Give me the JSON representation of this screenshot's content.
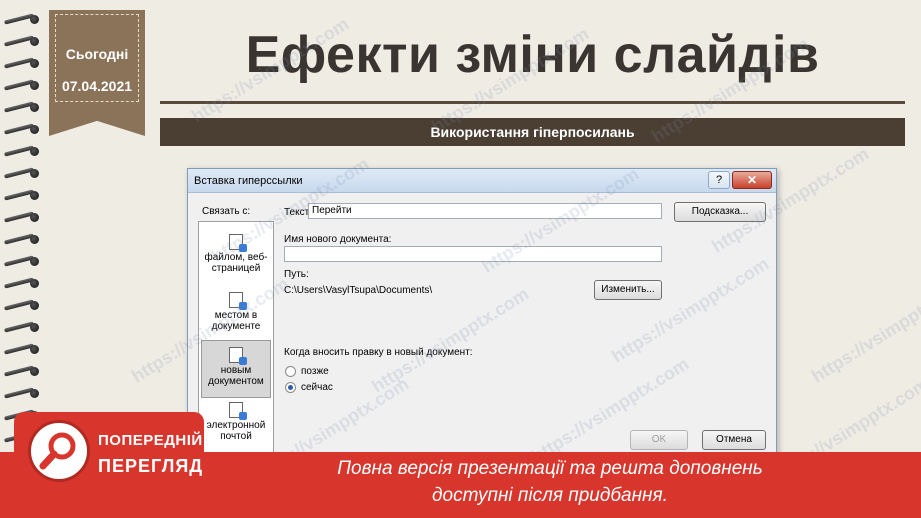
{
  "slide": {
    "today_label": "Сьогодні",
    "date": "07.04.2021",
    "title": "Ефекти зміни слайдів",
    "subtitle": "Використання гіперпосилань"
  },
  "dialog": {
    "title": "Вставка гиперссылки",
    "help": "?",
    "close": "✕",
    "link_to_label": "Связать с:",
    "places": [
      {
        "label": "файлом, веб-страницей",
        "icon": "file-web-icon",
        "selected": false
      },
      {
        "label": "местом в документе",
        "icon": "place-in-document-icon",
        "selected": false
      },
      {
        "label": "новым документом",
        "icon": "new-document-icon",
        "selected": true
      },
      {
        "label": "электронной почтой",
        "icon": "email-icon",
        "selected": false
      }
    ],
    "text_label": "Текст:",
    "text_value": "Перейти",
    "tooltip_button": "Подсказка...",
    "new_doc_name_label": "Имя нового документа:",
    "new_doc_name_value": "",
    "path_label": "Путь:",
    "path_value": "C:\\Users\\VasylTsupa\\Documents\\",
    "change_button": "Изменить...",
    "when_edit_label": "Когда вносить правку в новый документ:",
    "radio_later": "позже",
    "radio_now": "сейчас",
    "radio_selected": "now",
    "ok_button": "OK",
    "cancel_button": "Отмена"
  },
  "watermark": "https://vsimpptx.com",
  "preview": {
    "line1": "ПОПЕРЕДНІЙ",
    "line2": "ПЕРЕГЛЯД",
    "notice_line1": "Повна версія презентації та решта доповнень",
    "notice_line2": "доступні після придбання."
  },
  "colors": {
    "banner": "#d8362c",
    "title_bar": "#4b3f34",
    "date_tag": "#8a7358"
  }
}
